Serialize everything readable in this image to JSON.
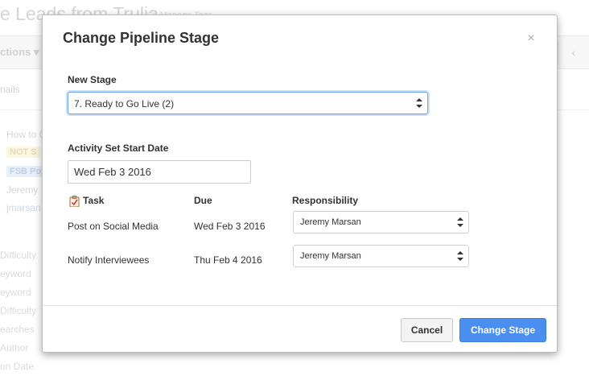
{
  "background": {
    "title": "e Leads from Trulia",
    "manage_tags": "Manage Tags",
    "actions": "ctions",
    "tab": "nails",
    "items": [
      "How to C",
      "NOT S",
      "FSB Po",
      "Jeremy",
      "jmarsan"
    ],
    "side_labels": [
      "Difficulty",
      "eyword",
      "eyword",
      "Difficulty",
      "earches",
      "Author",
      "on Date"
    ]
  },
  "modal": {
    "title": "Change Pipeline Stage",
    "close_glyph": "×",
    "new_stage_label": "New Stage",
    "new_stage_value": "7. Ready to Go Live (2)",
    "start_date_label": "Activity Set Start Date",
    "start_date_value": "Wed Feb 3 2016",
    "columns": {
      "task": "Task",
      "due": "Due",
      "responsibility": "Responsibility"
    },
    "tasks": [
      {
        "task": "Post on Social Media",
        "due": "Wed Feb 3 2016",
        "responsibility": "Jeremy Marsan"
      },
      {
        "task": "Notify Interviewees",
        "due": "Thu Feb 4 2016",
        "responsibility": "Jeremy Marsan"
      }
    ],
    "cancel_label": "Cancel",
    "submit_label": "Change Stage"
  },
  "colors": {
    "primary": "#4a8ff0",
    "focus": "#6fa5e3"
  }
}
